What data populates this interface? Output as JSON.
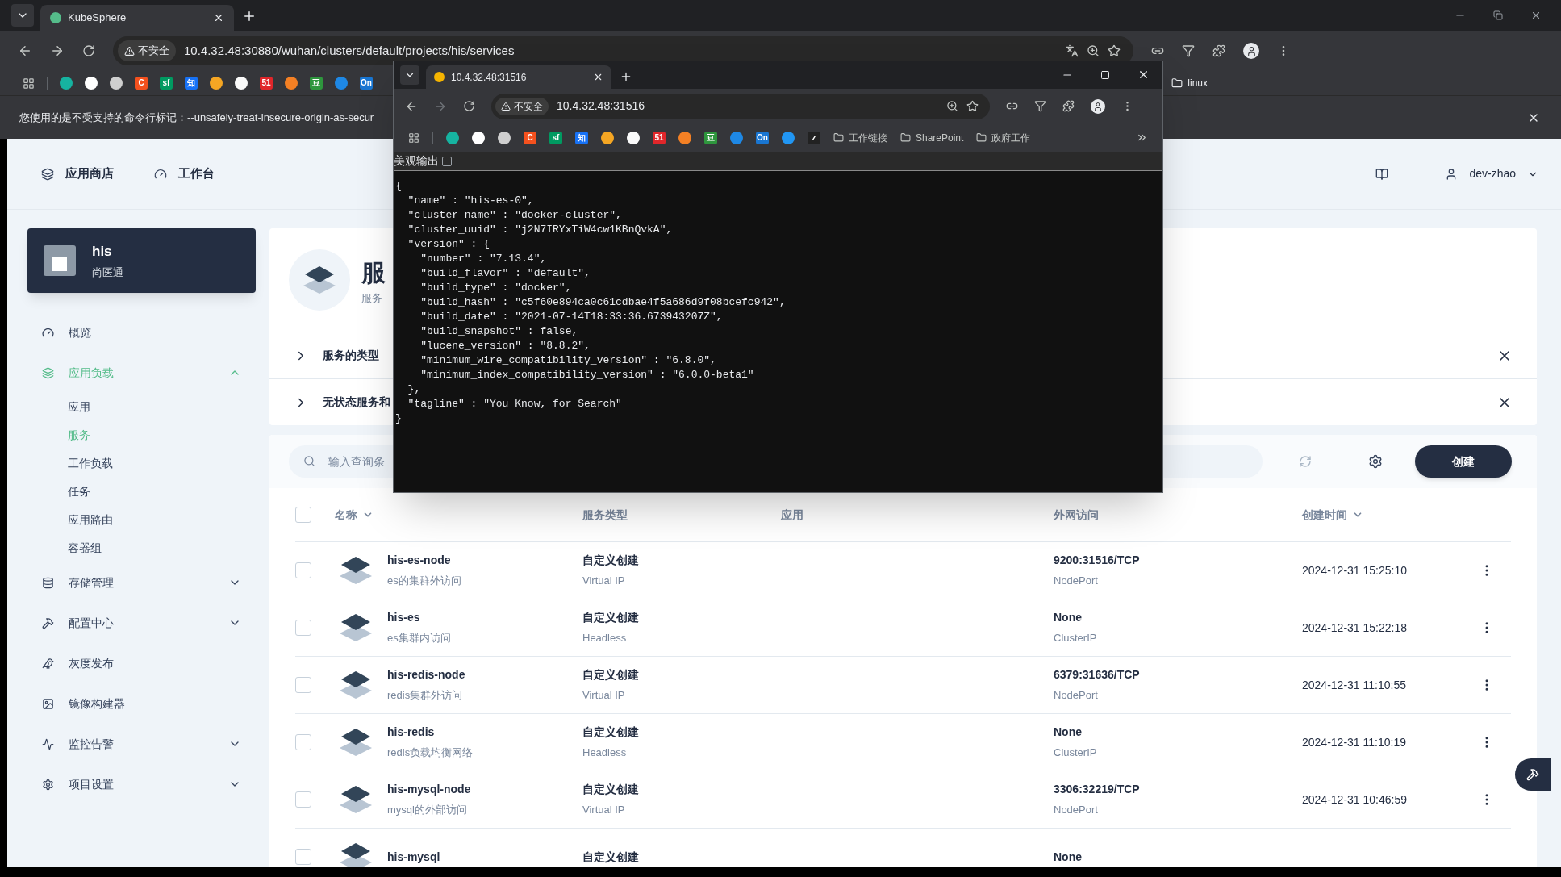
{
  "browser": {
    "tabs": [
      {
        "title": "KubeSphere",
        "selected": true
      }
    ],
    "security": "不安全",
    "url": "10.4.32.48:30880/wuhan/clusters/default/projects/his/services",
    "bookmarks": [
      {
        "kind": "icon",
        "color": "#16b3a0"
      },
      {
        "kind": "icon",
        "color": "#ffffff"
      },
      {
        "kind": "icon",
        "color": "#cfcfcf"
      },
      {
        "kind": "letter",
        "text": "C",
        "color": "#f4511e"
      },
      {
        "kind": "letter",
        "text": "sf",
        "color": "#009a61"
      },
      {
        "kind": "letter",
        "text": "知",
        "color": "#1772f6"
      },
      {
        "kind": "icon",
        "color": "#f5a623"
      },
      {
        "kind": "icon",
        "color": "#fafafa"
      },
      {
        "kind": "letter",
        "text": "51",
        "color": "#e0262a"
      },
      {
        "kind": "icon",
        "color": "#f48024"
      },
      {
        "kind": "letter",
        "text": "豆",
        "color": "#2e963d"
      },
      {
        "kind": "icon",
        "color": "#1e88e5"
      },
      {
        "kind": "letter",
        "text": "On",
        "color": "#1976d2"
      }
    ],
    "bookmark_folders": [
      "linux"
    ],
    "infobar": "您使用的是不受支持的命令行标记：--unsafely-treat-insecure-origin-as-secur"
  },
  "popup": {
    "tabs": [
      {
        "title": "10.4.32.48:31516",
        "selected": true
      }
    ],
    "security": "不安全",
    "url": "10.4.32.48:31516",
    "bookmarks": [
      {
        "kind": "icon",
        "color": "#16b3a0"
      },
      {
        "kind": "icon",
        "color": "#ffffff"
      },
      {
        "kind": "icon",
        "color": "#cfcfcf"
      },
      {
        "kind": "letter",
        "text": "C",
        "color": "#f4511e"
      },
      {
        "kind": "letter",
        "text": "sf",
        "color": "#009a61"
      },
      {
        "kind": "letter",
        "text": "知",
        "color": "#1772f6"
      },
      {
        "kind": "icon",
        "color": "#f5a623"
      },
      {
        "kind": "icon",
        "color": "#fafafa"
      },
      {
        "kind": "letter",
        "text": "51",
        "color": "#e0262a"
      },
      {
        "kind": "icon",
        "color": "#f48024"
      },
      {
        "kind": "letter",
        "text": "豆",
        "color": "#2e963d"
      },
      {
        "kind": "icon",
        "color": "#1e88e5"
      },
      {
        "kind": "letter",
        "text": "On",
        "color": "#1976d2"
      },
      {
        "kind": "icon",
        "color": "#2196f3"
      },
      {
        "kind": "letter",
        "text": "z",
        "color": "#222222"
      }
    ],
    "bookmark_folders": [
      "工作链接",
      "SharePoint",
      "政府工作"
    ],
    "pretty_print": {
      "label": "美观输出",
      "checked": false
    },
    "json_lines": [
      "{",
      "  \"name\" : \"his-es-0\",",
      "  \"cluster_name\" : \"docker-cluster\",",
      "  \"cluster_uuid\" : \"j2N7IRYxTiW4cw1KBnQvkA\",",
      "  \"version\" : {",
      "    \"number\" : \"7.13.4\",",
      "    \"build_flavor\" : \"default\",",
      "    \"build_type\" : \"docker\",",
      "    \"build_hash\" : \"c5f60e894ca0c61cdbae4f5a686d9f08bcefc942\",",
      "    \"build_date\" : \"2021-07-14T18:33:36.673943207Z\",",
      "    \"build_snapshot\" : false,",
      "    \"lucene_version\" : \"8.8.2\",",
      "    \"minimum_wire_compatibility_version\" : \"6.8.0\",",
      "    \"minimum_index_compatibility_version\" : \"6.0.0-beta1\"",
      "  },",
      "  \"tagline\" : \"You Know, for Search\"",
      "}"
    ]
  },
  "header": {
    "nav": [
      "应用商店",
      "工作台"
    ],
    "user": "dev-zhao"
  },
  "project": {
    "name": "his",
    "alias": "尚医通"
  },
  "sidebar": {
    "items": [
      {
        "kind": "link",
        "label": "概览",
        "selected": false
      },
      {
        "kind": "group",
        "label": "应用负载",
        "selected": true,
        "expanded": true,
        "children": [
          {
            "label": "应用",
            "selected": false
          },
          {
            "label": "服务",
            "selected": true
          },
          {
            "label": "工作负载",
            "selected": false
          },
          {
            "label": "任务",
            "selected": false
          },
          {
            "label": "应用路由",
            "selected": false
          },
          {
            "label": "容器组",
            "selected": false
          }
        ]
      },
      {
        "kind": "group",
        "label": "存储管理",
        "selected": false,
        "expanded": false
      },
      {
        "kind": "group",
        "label": "配置中心",
        "selected": false,
        "expanded": false
      },
      {
        "kind": "link",
        "label": "灰度发布",
        "selected": false
      },
      {
        "kind": "link",
        "label": "镜像构建器",
        "selected": false
      },
      {
        "kind": "group",
        "label": "监控告警",
        "selected": false,
        "expanded": false
      },
      {
        "kind": "group",
        "label": "项目设置",
        "selected": false,
        "expanded": false
      }
    ]
  },
  "banner": {
    "title": "服",
    "subtitle": "服务"
  },
  "notices": [
    {
      "title": "服务的类型"
    },
    {
      "title": "无状态服务和"
    }
  ],
  "toolbar": {
    "search_placeholder": "输入查询条",
    "create": "创建"
  },
  "table": {
    "select_all": {
      "checked": false
    },
    "columns": [
      {
        "label": "名称",
        "sortable": true
      },
      {
        "label": "服务类型",
        "sortable": false
      },
      {
        "label": "应用",
        "sortable": false
      },
      {
        "label": "外网访问",
        "sortable": false
      },
      {
        "label": "创建时间",
        "sortable": true
      }
    ],
    "rows": [
      {
        "checked": false,
        "name": "his-es-node",
        "description": "es的集群外访问",
        "type": "自定义创建",
        "type_detail": "Virtual IP",
        "access": "9200:31516/TCP",
        "access_type": "NodePort",
        "created": "2024-12-31 15:25:10"
      },
      {
        "checked": false,
        "name": "his-es",
        "description": "es集群内访问",
        "type": "自定义创建",
        "type_detail": "Headless",
        "access": "None",
        "access_type": "ClusterIP",
        "created": "2024-12-31 15:22:18"
      },
      {
        "checked": false,
        "name": "his-redis-node",
        "description": "redis集群外访问",
        "type": "自定义创建",
        "type_detail": "Virtual IP",
        "access": "6379:31636/TCP",
        "access_type": "NodePort",
        "created": "2024-12-31 11:10:55"
      },
      {
        "checked": false,
        "name": "his-redis",
        "description": "redis负载均衡网络",
        "type": "自定义创建",
        "type_detail": "Headless",
        "access": "None",
        "access_type": "ClusterIP",
        "created": "2024-12-31 11:10:19"
      },
      {
        "checked": false,
        "name": "his-mysql-node",
        "description": "mysql的外部访问",
        "type": "自定义创建",
        "type_detail": "Virtual IP",
        "access": "3306:32219/TCP",
        "access_type": "NodePort",
        "created": "2024-12-31 10:46:59"
      },
      {
        "checked": false,
        "name": "his-mysql",
        "type": "自定义创建",
        "access": "None"
      }
    ]
  }
}
